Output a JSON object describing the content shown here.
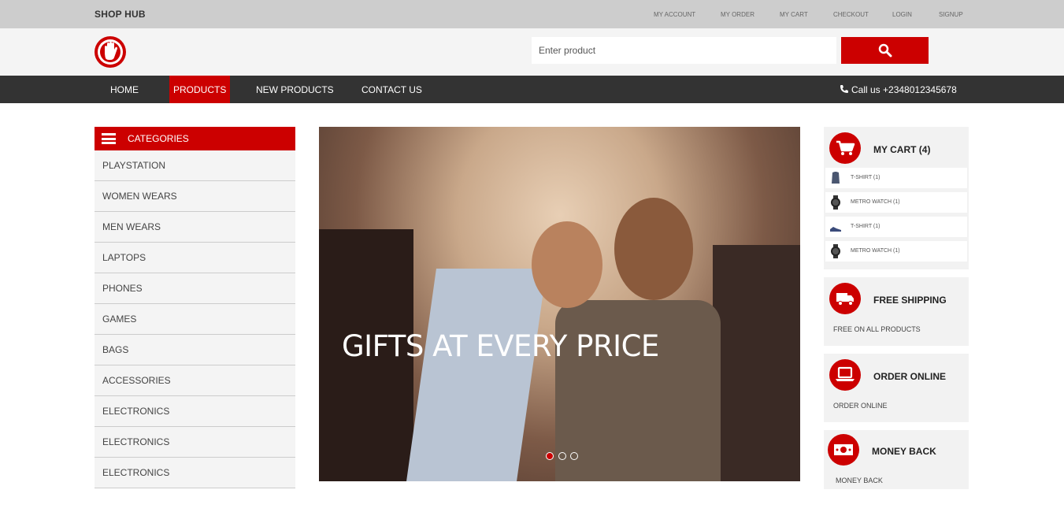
{
  "topbar": {
    "brand": "SHOP HUB",
    "links": [
      "MY ACCOUNT",
      "MY ORDER",
      "MY CART",
      "CHECKOUT",
      "LOGIN",
      "SIGNUP"
    ]
  },
  "search": {
    "placeholder": "Enter product"
  },
  "nav": {
    "items": [
      "HOME",
      "PRODUCTS",
      "NEW PRODUCTS",
      "CONTACT US"
    ],
    "active": "PRODUCTS",
    "call": "Call us +2348012345678"
  },
  "categories": {
    "title": "CATEGORIES",
    "items": [
      "PLAYSTATION",
      "WOMEN WEARS",
      "MEN WEARS",
      "LAPTOPS",
      "PHONES",
      "GAMES",
      "BAGS",
      "ACCESSORIES",
      "ELECTRONICS",
      "ELECTRONICS",
      "ELECTRONICS"
    ]
  },
  "hero": {
    "caption": "GIFTS AT EVERY PRICE",
    "slides": 3,
    "active_slide": 1
  },
  "cart": {
    "title": "MY CART (4)",
    "items": [
      {
        "label": "T-SHIRT (1)",
        "icon": "tshirt-thumb"
      },
      {
        "label": "METRO WATCH (1)",
        "icon": "watch-thumb"
      },
      {
        "label": "T-SHIRT (1)",
        "icon": "shoe-thumb"
      },
      {
        "label": "METRO WATCH (1)",
        "icon": "watch-thumb"
      }
    ]
  },
  "features": [
    {
      "title": "FREE SHIPPING",
      "sub": "FREE ON ALL PRODUCTS",
      "icon": "truck-icon"
    },
    {
      "title": "ORDER ONLINE",
      "sub": "ORDER ONLINE",
      "icon": "laptop-icon"
    },
    {
      "title": "MONEY BACK",
      "sub": "MONEY BACK",
      "icon": "money-icon"
    }
  ],
  "colors": {
    "accent": "#cc0000",
    "nav_bg": "#333333",
    "topbar_bg": "#cdcdcd"
  }
}
